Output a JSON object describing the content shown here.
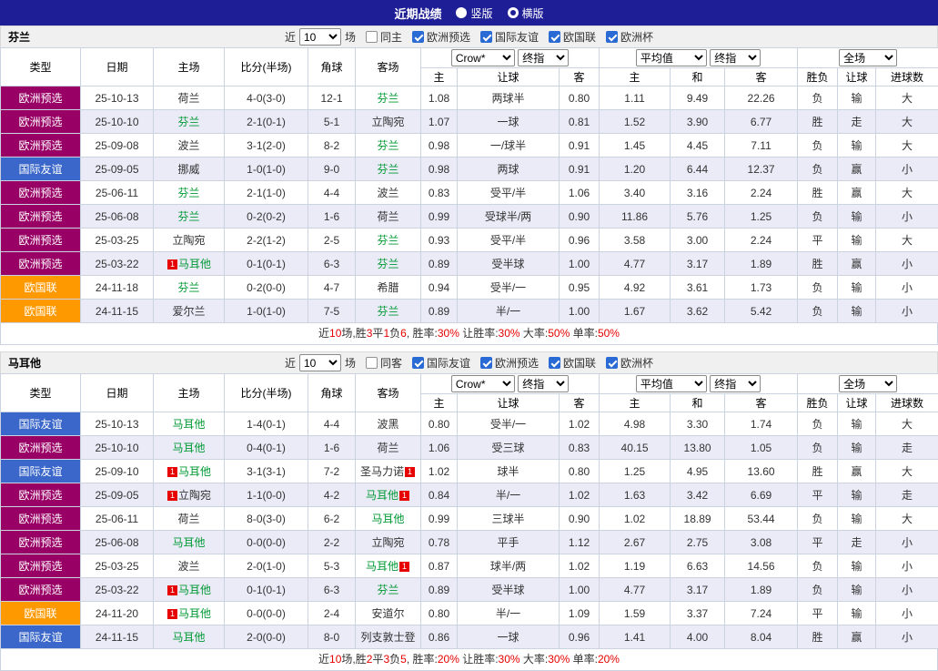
{
  "topbar": {
    "title": "近期战绩",
    "radios": [
      {
        "label": "竖版",
        "selected": false
      },
      {
        "label": "横版",
        "selected": true
      }
    ]
  },
  "colors": {
    "topbar_navy": "#1e1e96",
    "badge_purple": "#990066",
    "badge_blue": "#3a67c9",
    "badge_orange": "#ff9900",
    "row_alt": "#ebebf8",
    "win_red": "#e60000",
    "loss_blue": "#0000cc",
    "draw_green": "#009933"
  },
  "sections": [
    {
      "team": "芬兰",
      "near_label": "近",
      "count_value": "10",
      "games_label": "场",
      "same_label": "同主",
      "same_checked": false,
      "filters": [
        {
          "label": "欧洲预选",
          "checked": true
        },
        {
          "label": "国际友谊",
          "checked": true
        },
        {
          "label": "欧国联",
          "checked": true
        },
        {
          "label": "欧洲杯",
          "checked": true
        }
      ],
      "header": {
        "type": "类型",
        "date": "日期",
        "home": "主场",
        "score": "比分(半场)",
        "corner": "角球",
        "away": "客场",
        "odds_select1": "Crow*",
        "odds_select2": "终指",
        "avg_select1": "平均值",
        "avg_select2": "终指",
        "scope_select": "全场",
        "sub": [
          "主",
          "让球",
          "客",
          "主",
          "和",
          "客",
          "胜负",
          "让球",
          "进球数"
        ]
      },
      "rows": [
        {
          "league": "欧洲预选",
          "league_color": "purple",
          "date": "25-10-13",
          "home": "荷兰",
          "home_focus": false,
          "home_red": "",
          "score": "4-0(3-0)",
          "corner": "12-1",
          "away": "芬兰",
          "away_focus": true,
          "away_red": "",
          "odds": [
            "1.08",
            "两球半",
            "0.80"
          ],
          "avg": [
            "1.11",
            "9.49",
            "22.26"
          ],
          "result": [
            "负",
            "blue"
          ],
          "handicap": [
            "输",
            "blue"
          ],
          "goals": [
            "大",
            "red"
          ]
        },
        {
          "league": "欧洲预选",
          "league_color": "purple",
          "date": "25-10-10",
          "home": "芬兰",
          "home_focus": true,
          "home_red": "",
          "score": "2-1(0-1)",
          "corner": "5-1",
          "away": "立陶宛",
          "away_focus": false,
          "away_red": "",
          "odds": [
            "1.07",
            "一球",
            "0.81"
          ],
          "avg": [
            "1.52",
            "3.90",
            "6.77"
          ],
          "result": [
            "胜",
            "red"
          ],
          "handicap": [
            "走",
            "green"
          ],
          "goals": [
            "大",
            "red"
          ]
        },
        {
          "league": "欧洲预选",
          "league_color": "purple",
          "date": "25-09-08",
          "home": "波兰",
          "home_focus": false,
          "home_red": "",
          "score": "3-1(2-0)",
          "corner": "8-2",
          "away": "芬兰",
          "away_focus": true,
          "away_red": "",
          "odds": [
            "0.98",
            "一/球半",
            "0.91"
          ],
          "avg": [
            "1.45",
            "4.45",
            "7.11"
          ],
          "result": [
            "负",
            "blue"
          ],
          "handicap": [
            "输",
            "blue"
          ],
          "goals": [
            "大",
            "red"
          ]
        },
        {
          "league": "国际友谊",
          "league_color": "blue",
          "date": "25-09-05",
          "home": "挪威",
          "home_focus": false,
          "home_red": "",
          "score": "1-0(1-0)",
          "corner": "9-0",
          "away": "芬兰",
          "away_focus": true,
          "away_red": "",
          "odds": [
            "0.98",
            "两球",
            "0.91"
          ],
          "avg": [
            "1.20",
            "6.44",
            "12.37"
          ],
          "result": [
            "负",
            "blue"
          ],
          "handicap": [
            "赢",
            "red"
          ],
          "goals": [
            "小",
            "blue"
          ]
        },
        {
          "league": "欧洲预选",
          "league_color": "purple",
          "date": "25-06-11",
          "home": "芬兰",
          "home_focus": true,
          "home_red": "",
          "score": "2-1(1-0)",
          "corner": "4-4",
          "away": "波兰",
          "away_focus": false,
          "away_red": "",
          "odds": [
            "0.83",
            "受平/半",
            "1.06"
          ],
          "avg": [
            "3.40",
            "3.16",
            "2.24"
          ],
          "result": [
            "胜",
            "red"
          ],
          "handicap": [
            "赢",
            "red"
          ],
          "goals": [
            "大",
            "red"
          ]
        },
        {
          "league": "欧洲预选",
          "league_color": "purple",
          "date": "25-06-08",
          "home": "芬兰",
          "home_focus": true,
          "home_red": "",
          "score": "0-2(0-2)",
          "corner": "1-6",
          "away": "荷兰",
          "away_focus": false,
          "away_red": "",
          "odds": [
            "0.99",
            "受球半/两",
            "0.90"
          ],
          "avg": [
            "11.86",
            "5.76",
            "1.25"
          ],
          "result": [
            "负",
            "blue"
          ],
          "handicap": [
            "输",
            "blue"
          ],
          "goals": [
            "小",
            "blue"
          ]
        },
        {
          "league": "欧洲预选",
          "league_color": "purple",
          "date": "25-03-25",
          "home": "立陶宛",
          "home_focus": false,
          "home_red": "",
          "score": "2-2(1-2)",
          "corner": "2-5",
          "away": "芬兰",
          "away_focus": true,
          "away_red": "",
          "odds": [
            "0.93",
            "受平/半",
            "0.96"
          ],
          "avg": [
            "3.58",
            "3.00",
            "2.24"
          ],
          "result": [
            "平",
            "green"
          ],
          "handicap": [
            "输",
            "blue"
          ],
          "goals": [
            "大",
            "red"
          ]
        },
        {
          "league": "欧洲预选",
          "league_color": "purple",
          "date": "25-03-22",
          "home": "马耳他",
          "home_focus": true,
          "home_red": "before",
          "score": "0-1(0-1)",
          "corner": "6-3",
          "away": "芬兰",
          "away_focus": true,
          "away_red": "",
          "odds": [
            "0.89",
            "受半球",
            "1.00"
          ],
          "avg": [
            "4.77",
            "3.17",
            "1.89"
          ],
          "result": [
            "胜",
            "red"
          ],
          "handicap": [
            "赢",
            "red"
          ],
          "goals": [
            "小",
            "blue"
          ]
        },
        {
          "league": "欧国联",
          "league_color": "orange",
          "date": "24-11-18",
          "home": "芬兰",
          "home_focus": true,
          "home_red": "",
          "score": "0-2(0-0)",
          "corner": "4-7",
          "away": "希腊",
          "away_focus": false,
          "away_red": "",
          "odds": [
            "0.94",
            "受半/一",
            "0.95"
          ],
          "avg": [
            "4.92",
            "3.61",
            "1.73"
          ],
          "result": [
            "负",
            "blue"
          ],
          "handicap": [
            "输",
            "blue"
          ],
          "goals": [
            "小",
            "blue"
          ]
        },
        {
          "league": "欧国联",
          "league_color": "orange",
          "date": "24-11-15",
          "home": "爱尔兰",
          "home_focus": false,
          "home_red": "",
          "score": "1-0(1-0)",
          "corner": "7-5",
          "away": "芬兰",
          "away_focus": true,
          "away_red": "",
          "odds": [
            "0.89",
            "半/一",
            "1.00"
          ],
          "avg": [
            "1.67",
            "3.62",
            "5.42"
          ],
          "result": [
            "负",
            "blue"
          ],
          "handicap": [
            "输",
            "blue"
          ],
          "goals": [
            "小",
            "blue"
          ]
        }
      ],
      "summary": [
        "近",
        "10",
        "场,胜",
        "3",
        "平",
        "1",
        "负",
        "6",
        ", 胜率:",
        "30%",
        " 让胜率:",
        "30%",
        " 大率:",
        "50%",
        " 单率:",
        "50%"
      ]
    },
    {
      "team": "马耳他",
      "near_label": "近",
      "count_value": "10",
      "games_label": "场",
      "same_label": "同客",
      "same_checked": false,
      "filters": [
        {
          "label": "国际友谊",
          "checked": true
        },
        {
          "label": "欧洲预选",
          "checked": true
        },
        {
          "label": "欧国联",
          "checked": true
        },
        {
          "label": "欧洲杯",
          "checked": true
        }
      ],
      "header": {
        "type": "类型",
        "date": "日期",
        "home": "主场",
        "score": "比分(半场)",
        "corner": "角球",
        "away": "客场",
        "odds_select1": "Crow*",
        "odds_select2": "终指",
        "avg_select1": "平均值",
        "avg_select2": "终指",
        "scope_select": "全场",
        "sub": [
          "主",
          "让球",
          "客",
          "主",
          "和",
          "客",
          "胜负",
          "让球",
          "进球数"
        ]
      },
      "rows": [
        {
          "league": "国际友谊",
          "league_color": "blue",
          "date": "25-10-13",
          "home": "马耳他",
          "home_focus": true,
          "home_red": "",
          "score": "1-4(0-1)",
          "corner": "4-4",
          "away": "波黑",
          "away_focus": false,
          "away_red": "",
          "odds": [
            "0.80",
            "受半/一",
            "1.02"
          ],
          "avg": [
            "4.98",
            "3.30",
            "1.74"
          ],
          "result": [
            "负",
            "blue"
          ],
          "handicap": [
            "输",
            "blue"
          ],
          "goals": [
            "大",
            "red"
          ]
        },
        {
          "league": "欧洲预选",
          "league_color": "purple",
          "date": "25-10-10",
          "home": "马耳他",
          "home_focus": true,
          "home_red": "",
          "score": "0-4(0-1)",
          "corner": "1-6",
          "away": "荷兰",
          "away_focus": false,
          "away_red": "",
          "odds": [
            "1.06",
            "受三球",
            "0.83"
          ],
          "avg": [
            "40.15",
            "13.80",
            "1.05"
          ],
          "result": [
            "负",
            "blue"
          ],
          "handicap": [
            "输",
            "blue"
          ],
          "goals": [
            "走",
            "green"
          ]
        },
        {
          "league": "国际友谊",
          "league_color": "blue",
          "date": "25-09-10",
          "home": "马耳他",
          "home_focus": true,
          "home_red": "before",
          "score": "3-1(3-1)",
          "corner": "7-2",
          "away": "圣马力诺",
          "away_focus": false,
          "away_red": "after",
          "odds": [
            "1.02",
            "球半",
            "0.80"
          ],
          "avg": [
            "1.25",
            "4.95",
            "13.60"
          ],
          "result": [
            "胜",
            "red"
          ],
          "handicap": [
            "赢",
            "red"
          ],
          "goals": [
            "大",
            "red"
          ]
        },
        {
          "league": "欧洲预选",
          "league_color": "purple",
          "date": "25-09-05",
          "home": "立陶宛",
          "home_focus": false,
          "home_red": "before",
          "score": "1-1(0-0)",
          "corner": "4-2",
          "away": "马耳他",
          "away_focus": true,
          "away_red": "after",
          "odds": [
            "0.84",
            "半/一",
            "1.02"
          ],
          "avg": [
            "1.63",
            "3.42",
            "6.69"
          ],
          "result": [
            "平",
            "green"
          ],
          "handicap": [
            "输",
            "blue"
          ],
          "goals": [
            "走",
            "green"
          ]
        },
        {
          "league": "欧洲预选",
          "league_color": "purple",
          "date": "25-06-11",
          "home": "荷兰",
          "home_focus": false,
          "home_red": "",
          "score": "8-0(3-0)",
          "corner": "6-2",
          "away": "马耳他",
          "away_focus": true,
          "away_red": "",
          "odds": [
            "0.99",
            "三球半",
            "0.90"
          ],
          "avg": [
            "1.02",
            "18.89",
            "53.44"
          ],
          "result": [
            "负",
            "blue"
          ],
          "handicap": [
            "输",
            "blue"
          ],
          "goals": [
            "大",
            "red"
          ]
        },
        {
          "league": "欧洲预选",
          "league_color": "purple",
          "date": "25-06-08",
          "home": "马耳他",
          "home_focus": true,
          "home_red": "",
          "score": "0-0(0-0)",
          "corner": "2-2",
          "away": "立陶宛",
          "away_focus": false,
          "away_red": "",
          "odds": [
            "0.78",
            "平手",
            "1.12"
          ],
          "avg": [
            "2.67",
            "2.75",
            "3.08"
          ],
          "result": [
            "平",
            "green"
          ],
          "handicap": [
            "走",
            "green"
          ],
          "goals": [
            "小",
            "blue"
          ]
        },
        {
          "league": "欧洲预选",
          "league_color": "purple",
          "date": "25-03-25",
          "home": "波兰",
          "home_focus": false,
          "home_red": "",
          "score": "2-0(1-0)",
          "corner": "5-3",
          "away": "马耳他",
          "away_focus": true,
          "away_red": "after",
          "odds": [
            "0.87",
            "球半/两",
            "1.02"
          ],
          "avg": [
            "1.19",
            "6.63",
            "14.56"
          ],
          "result": [
            "负",
            "blue"
          ],
          "handicap": [
            "输",
            "blue"
          ],
          "goals": [
            "小",
            "blue"
          ]
        },
        {
          "league": "欧洲预选",
          "league_color": "purple",
          "date": "25-03-22",
          "home": "马耳他",
          "home_focus": true,
          "home_red": "before",
          "score": "0-1(0-1)",
          "corner": "6-3",
          "away": "芬兰",
          "away_focus": true,
          "away_red": "",
          "odds": [
            "0.89",
            "受半球",
            "1.00"
          ],
          "avg": [
            "4.77",
            "3.17",
            "1.89"
          ],
          "result": [
            "负",
            "blue"
          ],
          "handicap": [
            "输",
            "blue"
          ],
          "goals": [
            "小",
            "blue"
          ]
        },
        {
          "league": "欧国联",
          "league_color": "orange",
          "date": "24-11-20",
          "home": "马耳他",
          "home_focus": true,
          "home_red": "before",
          "score": "0-0(0-0)",
          "corner": "2-4",
          "away": "安道尔",
          "away_focus": false,
          "away_red": "",
          "odds": [
            "0.80",
            "半/一",
            "1.09"
          ],
          "avg": [
            "1.59",
            "3.37",
            "7.24"
          ],
          "result": [
            "平",
            "green"
          ],
          "handicap": [
            "输",
            "blue"
          ],
          "goals": [
            "小",
            "blue"
          ]
        },
        {
          "league": "国际友谊",
          "league_color": "blue",
          "date": "24-11-15",
          "home": "马耳他",
          "home_focus": true,
          "home_red": "",
          "score": "2-0(0-0)",
          "corner": "8-0",
          "away": "列支敦士登",
          "away_focus": false,
          "away_red": "",
          "odds": [
            "0.86",
            "一球",
            "0.96"
          ],
          "avg": [
            "1.41",
            "4.00",
            "8.04"
          ],
          "result": [
            "胜",
            "red"
          ],
          "handicap": [
            "赢",
            "red"
          ],
          "goals": [
            "小",
            "blue"
          ]
        }
      ],
      "summary": [
        "近",
        "10",
        "场,胜",
        "2",
        "平",
        "3",
        "负",
        "5",
        ", 胜率:",
        "20%",
        " 让胜率:",
        "30%",
        " 大率:",
        "30%",
        " 单率:",
        "20%"
      ]
    }
  ]
}
